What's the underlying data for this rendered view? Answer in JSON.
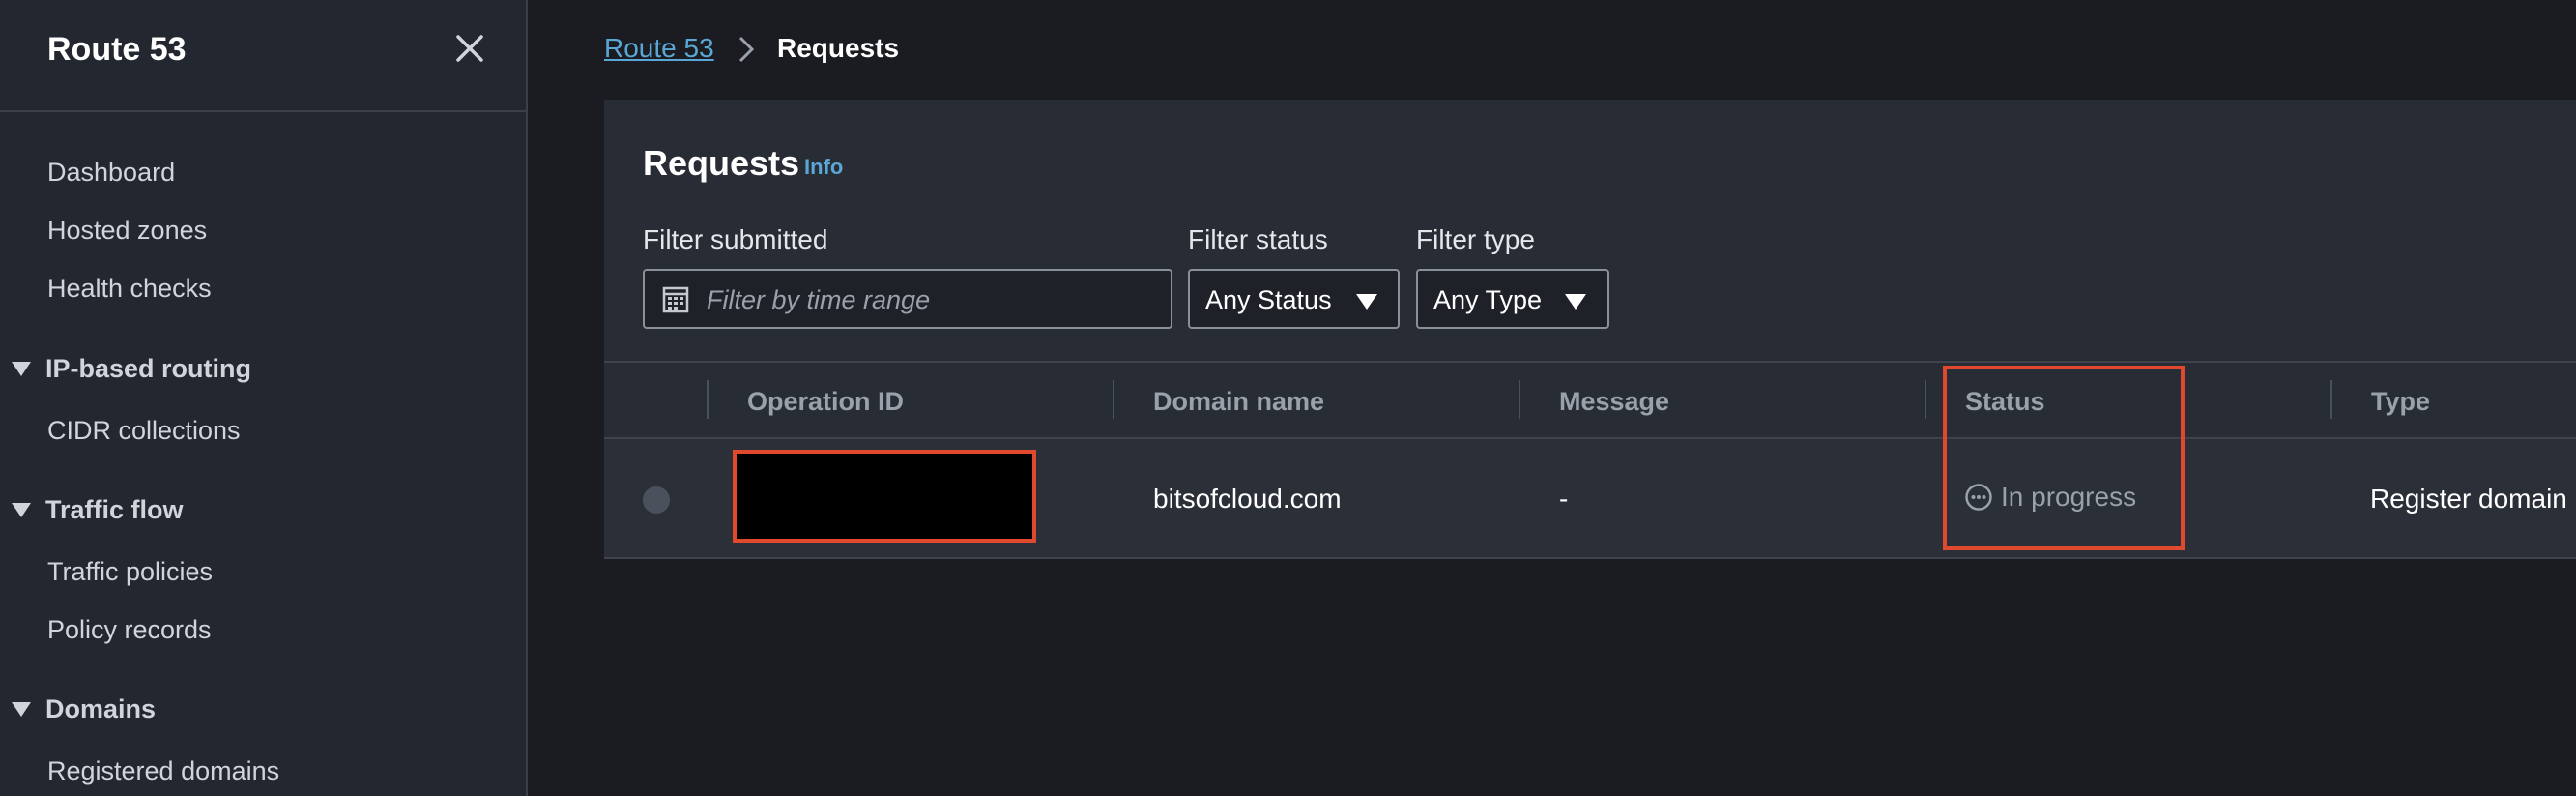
{
  "sidebar": {
    "title": "Route 53",
    "items": [
      {
        "label": "Dashboard"
      },
      {
        "label": "Hosted zones"
      },
      {
        "label": "Health checks"
      }
    ],
    "sections": [
      {
        "label": "IP-based routing",
        "items": [
          {
            "label": "CIDR collections"
          }
        ]
      },
      {
        "label": "Traffic flow",
        "items": [
          {
            "label": "Traffic policies"
          },
          {
            "label": "Policy records"
          }
        ]
      },
      {
        "label": "Domains",
        "items": [
          {
            "label": "Registered domains"
          }
        ]
      }
    ]
  },
  "breadcrumb": {
    "root": "Route 53",
    "current": "Requests"
  },
  "panel": {
    "title": "Requests",
    "info": "Info",
    "filters": {
      "submitted": {
        "label": "Filter submitted",
        "placeholder": "Filter by time range"
      },
      "status": {
        "label": "Filter status",
        "value": "Any Status"
      },
      "type": {
        "label": "Filter type",
        "value": "Any Type"
      }
    }
  },
  "table": {
    "columns": [
      "Operation ID",
      "Domain name",
      "Message",
      "Status",
      "Type"
    ],
    "rows": [
      {
        "operation_id": "",
        "domain": "bitsofcloud.com",
        "message": "-",
        "status": "In progress",
        "type": "Register domain"
      }
    ]
  },
  "colors": {
    "accent_link": "#5aa7d6",
    "highlight": "#e0492e"
  }
}
